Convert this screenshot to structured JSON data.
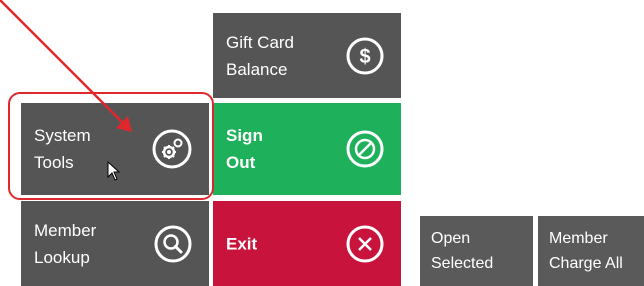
{
  "tiles": {
    "gift_card": {
      "label": "Gift Card\nBalance",
      "icon": "dollar-icon"
    },
    "system_tools": {
      "label": "System\nTools",
      "icon": "gears-icon"
    },
    "sign_out": {
      "label": "Sign\nOut",
      "icon": "cancel-circle-icon"
    },
    "member_lookup": {
      "label": "Member\nLookup",
      "icon": "search-icon"
    },
    "exit": {
      "label": "Exit",
      "icon": "close-circle-icon"
    },
    "open_selected": {
      "label": "Open\nSelected"
    },
    "member_charge_all": {
      "label": "Member\nCharge All"
    }
  },
  "colors": {
    "dark_tile": "#555555",
    "green_tile": "#1eb05a",
    "red_tile": "#c8143c",
    "annotation": "#e0282c"
  }
}
